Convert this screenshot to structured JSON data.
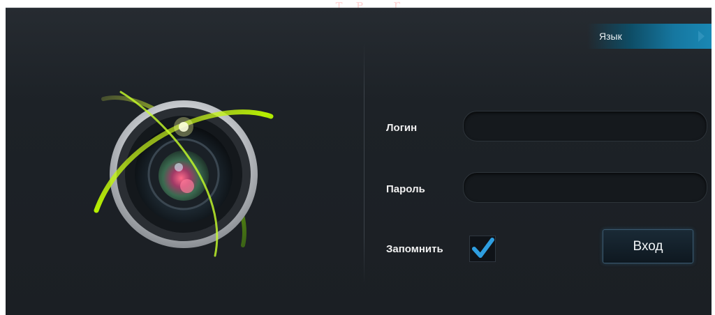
{
  "header": {
    "language_label": "Язык"
  },
  "form": {
    "login_label": "Логин",
    "login_value": "",
    "password_label": "Пароль",
    "password_value": "",
    "remember_label": "Запомнить",
    "remember_checked": true,
    "submit_label": "Вход"
  },
  "colors": {
    "panel_background": "#1d2227",
    "accent": "#1a88b4",
    "check": "#2e9ee0",
    "logo_ring": "#c8cbcf",
    "swirl_green": "#a6e000"
  }
}
